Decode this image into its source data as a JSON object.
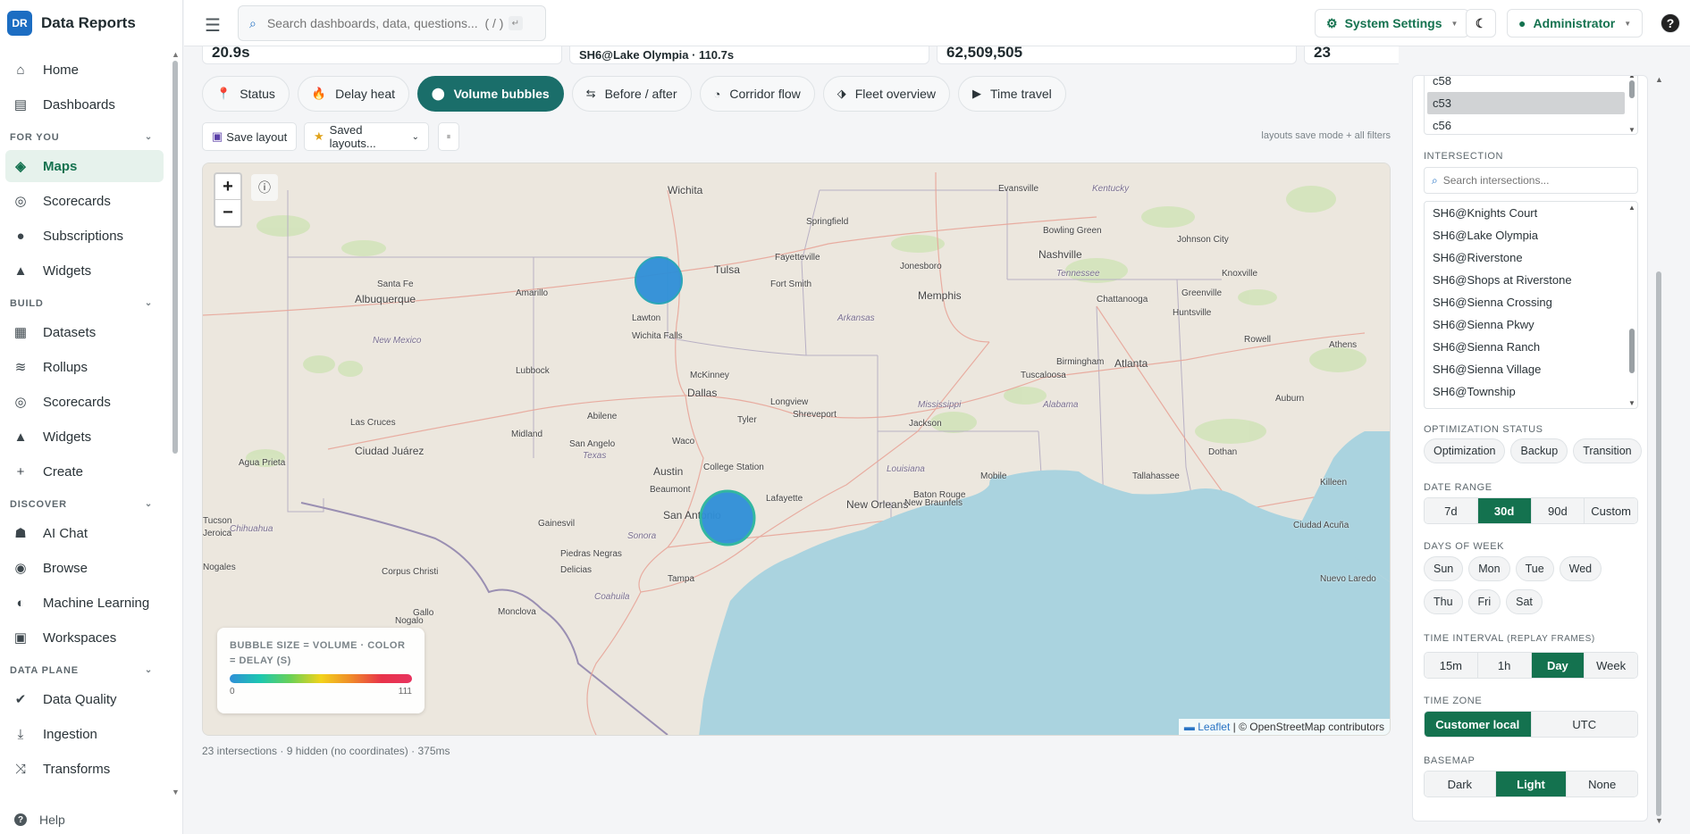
{
  "brand": {
    "logo": "DR",
    "name": "Data Reports"
  },
  "sidebar": {
    "items": [
      {
        "label": "Home",
        "icon": "home-icon",
        "glyph": "⌂"
      },
      {
        "label": "Dashboards",
        "icon": "dashboard-icon",
        "glyph": "▤"
      }
    ],
    "sections": [
      {
        "title": "FOR YOU",
        "items": [
          {
            "label": "Maps",
            "icon": "map-icon",
            "glyph": "◈",
            "active": true
          },
          {
            "label": "Scorecards",
            "icon": "target-icon",
            "glyph": "◎"
          },
          {
            "label": "Subscriptions",
            "icon": "subscription-icon",
            "glyph": "●"
          },
          {
            "label": "Widgets",
            "icon": "widgets-icon",
            "glyph": "▲"
          }
        ]
      },
      {
        "title": "BUILD",
        "items": [
          {
            "label": "Datasets",
            "icon": "table-icon",
            "glyph": "▦"
          },
          {
            "label": "Rollups",
            "icon": "layers-icon",
            "glyph": "≋"
          },
          {
            "label": "Scorecards",
            "icon": "target-icon",
            "glyph": "◎"
          },
          {
            "label": "Widgets",
            "icon": "widgets-icon",
            "glyph": "▲"
          },
          {
            "label": "Create",
            "icon": "plus-icon",
            "glyph": "+"
          }
        ]
      },
      {
        "title": "DISCOVER",
        "items": [
          {
            "label": "AI Chat",
            "icon": "robot-icon",
            "glyph": "☗"
          },
          {
            "label": "Browse",
            "icon": "compass-icon",
            "glyph": "◉"
          },
          {
            "label": "Machine Learning",
            "icon": "brain-icon",
            "glyph": "◐"
          },
          {
            "label": "Workspaces",
            "icon": "workspace-icon",
            "glyph": "▣"
          }
        ]
      },
      {
        "title": "DATA PLANE",
        "items": [
          {
            "label": "Data Quality",
            "icon": "check-circle-icon",
            "glyph": "✔"
          },
          {
            "label": "Ingestion",
            "icon": "download-icon",
            "glyph": "⤓"
          },
          {
            "label": "Transforms",
            "icon": "shuffle-icon",
            "glyph": "⤨"
          }
        ]
      }
    ],
    "help": "Help"
  },
  "topbar": {
    "search_placeholder": "Search dashboards, data, questions...  ( / )",
    "system_settings": "System Settings",
    "theme_toggle_glyph": "☾",
    "user": "Administrator",
    "help_glyph": "?"
  },
  "kpis": [
    "20.9s",
    "SH6@Lake Olympia · 110.7s",
    "62,509,505",
    "23"
  ],
  "view_tabs": [
    {
      "label": "Status",
      "icon": "pin-icon",
      "glyph": "📍"
    },
    {
      "label": "Delay heat",
      "icon": "flame-icon",
      "glyph": "🔥"
    },
    {
      "label": "Volume bubbles",
      "icon": "circle-icon",
      "glyph": "⬤",
      "active": true
    },
    {
      "label": "Before / after",
      "icon": "swap-icon",
      "glyph": "⇆"
    },
    {
      "label": "Corridor flow",
      "icon": "wave-icon",
      "glyph": "◔"
    },
    {
      "label": "Fleet overview",
      "icon": "fleet-icon",
      "glyph": "⬗"
    },
    {
      "label": "Time travel",
      "icon": "play-icon",
      "glyph": "▶"
    }
  ],
  "toolbar": {
    "save_layout": "Save layout",
    "saved_layouts": "Saved layouts...",
    "pause_glyph": "⏸",
    "note": "layouts save mode + all filters"
  },
  "map": {
    "zoom_in": "+",
    "zoom_out": "−",
    "info_glyph": "ⓘ",
    "legend_title": "BUBBLE SIZE = VOLUME · COLOR = DELAY (S)",
    "legend_min": "0",
    "legend_max": "111",
    "attribution_leaflet": "Leaflet",
    "attribution_rest": " | © OpenStreetMap contributors",
    "bubble_color": "#2f8fd8",
    "cities": [
      "Wichita",
      "Springfield",
      "Evansville",
      "Kentucky",
      "Bowling Green",
      "Nashville",
      "Johnson City",
      "Tulsa",
      "Fayetteville",
      "Jonesboro",
      "Tennessee",
      "Knoxville",
      "Greenville",
      "Santa Fe",
      "Albuquerque",
      "Amarillo",
      "Fort Smith",
      "Memphis",
      "Chattanooga",
      "Lawton",
      "Wichita Falls",
      "Arkansas",
      "Huntsville",
      "New Mexico",
      "Rowell",
      "Athens",
      "Lubbock",
      "McKinney",
      "Birmingham",
      "Atlanta",
      "Dallas",
      "Longview",
      "Tuscaloosa",
      "Mississippi",
      "Alabama",
      "Auburn",
      "Abilene",
      "Shreveport",
      "Tyler",
      "Las Cruces",
      "Jackson",
      "Ciudad Juárez",
      "Midland",
      "San Angelo",
      "Waco",
      "Texas",
      "Dothan",
      "Agua Prieta",
      "College Station",
      "Louisiana",
      "Baton Rouge",
      "Mobile",
      "Tallahassee",
      "Killeen",
      "Austin",
      "Beaumont",
      "Lafayette",
      "New Orleans",
      "New Braunfels",
      "Ciudad Acuña",
      "San Antonio",
      "Gainesvil",
      "Sonora",
      "Chihuahua",
      "Piedras Negras",
      "Delicias",
      "Corpus Christi",
      "Tampa",
      "Nuevo Laredo",
      "Coahuila",
      "Monclova",
      "Jacl",
      "Gallo",
      "Nogales",
      "Jeroica",
      "Tucson",
      "Nogalo"
    ]
  },
  "footnote": "23 intersections · 9 hidden (no coordinates) · 375ms",
  "panel": {
    "top_list": [
      {
        "label": "c58",
        "selected": false
      },
      {
        "label": "c53",
        "selected": true
      },
      {
        "label": "c56",
        "selected": false
      }
    ],
    "intersection_label": "INTERSECTION",
    "intersection_placeholder": "Search intersections...",
    "intersections": [
      "SH6@Knights Court",
      "SH6@Lake Olympia",
      "SH6@Riverstone",
      "SH6@Shops at Riverstone",
      "SH6@Sienna Crossing",
      "SH6@Sienna Pkwy",
      "SH6@Sienna Ranch",
      "SH6@Sienna Village",
      "SH6@Township"
    ],
    "opt_label": "OPTIMIZATION STATUS",
    "opt_chips": [
      "Optimization",
      "Backup",
      "Transition"
    ],
    "date_label": "DATE RANGE",
    "date_options": [
      {
        "l": "7d"
      },
      {
        "l": "30d",
        "on": true
      },
      {
        "l": "90d"
      },
      {
        "l": "Custom"
      }
    ],
    "days_label": "DAYS OF WEEK",
    "days_row1": [
      "Sun",
      "Mon",
      "Tue",
      "Wed"
    ],
    "days_row2": [
      "Thu",
      "Fri",
      "Sat"
    ],
    "interval_label": "TIME INTERVAL",
    "interval_sub": "(REPLAY FRAMES)",
    "interval_options": [
      {
        "l": "15m"
      },
      {
        "l": "1h"
      },
      {
        "l": "Day",
        "on": true
      },
      {
        "l": "Week"
      }
    ],
    "tz_label": "TIME ZONE",
    "tz_options": [
      {
        "l": "Customer local",
        "on": true
      },
      {
        "l": "UTC"
      }
    ],
    "basemap_label": "BASEMAP",
    "basemap_options": [
      {
        "l": "Dark"
      },
      {
        "l": "Light",
        "on": true
      },
      {
        "l": "None"
      }
    ]
  },
  "colors": {
    "accent": "#14724f",
    "tab_active": "#1a6e6a",
    "brand": "#1c6dc2",
    "water": "#aad3df",
    "land": "#ece7de"
  }
}
